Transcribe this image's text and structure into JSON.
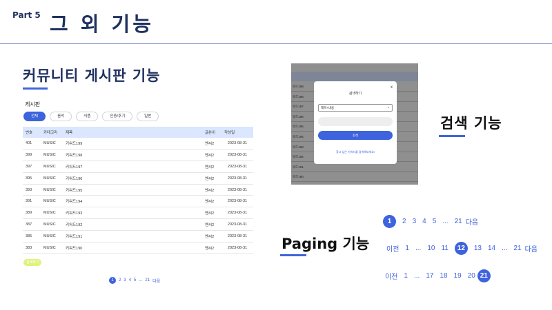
{
  "header": {
    "part": "Part 5",
    "title": "그 외 기능"
  },
  "sections": {
    "community": "커뮤니티 게시판 기능",
    "search": "검색 기능",
    "paging": "Paging 기능"
  },
  "board": {
    "title": "게시판",
    "categories": [
      "전체",
      "음악",
      "식품",
      "인증/후기",
      "일반"
    ],
    "columns": [
      "번호",
      "카테고리",
      "제목",
      "글쓴이",
      "작성일"
    ],
    "rows": [
      [
        "401",
        "MUSIC",
        "키워드199",
        "옌씨2",
        "2023-08-31"
      ],
      [
        "399",
        "MUSIC",
        "키워드198",
        "옌씨2",
        "2023-08-31"
      ],
      [
        "397",
        "MUSIC",
        "키워드197",
        "옌씨2",
        "2023-08-31"
      ],
      [
        "395",
        "MUSIC",
        "키워드196",
        "옌씨2",
        "2023-08-31"
      ],
      [
        "393",
        "MUSIC",
        "키워드195",
        "옌씨2",
        "2023-08-31"
      ],
      [
        "391",
        "MUSIC",
        "키워드194",
        "옌씨2",
        "2023-08-31"
      ],
      [
        "389",
        "MUSIC",
        "키워드193",
        "옌씨2",
        "2023-08-31"
      ],
      [
        "387",
        "MUSIC",
        "키워드192",
        "옌씨2",
        "2023-08-31"
      ],
      [
        "385",
        "MUSIC",
        "키워드191",
        "옌씨2",
        "2023-08-31"
      ],
      [
        "383",
        "MUSIC",
        "키워드190",
        "옌씨2",
        "2023-08-31"
      ]
    ],
    "write_label": "검색하기",
    "pager": [
      "1",
      "2",
      "3",
      "4",
      "5",
      "...",
      "21",
      "다음"
    ]
  },
  "search_modal": {
    "bg_rows": [
      "워드199",
      "워드198",
      "워드197",
      "워드196",
      "워드195",
      "워드194",
      "워드193",
      "워드192",
      "워드191",
      "워드190"
    ],
    "close": "x",
    "title": "검색하기",
    "select_value": "제목+내용",
    "button": "검색",
    "hint": "찾고 싶은 키워드를 검색해보세요!"
  },
  "paging": {
    "row1": [
      "1",
      "2",
      "3",
      "4",
      "5",
      "...",
      "21",
      "다음"
    ],
    "row2": [
      "이전",
      "1",
      "...",
      "10",
      "11",
      "12",
      "13",
      "14",
      "...",
      "21",
      "다음"
    ],
    "row3": [
      "이전",
      "1",
      "...",
      "17",
      "18",
      "19",
      "20",
      "21"
    ],
    "current1": "1",
    "current2": "12",
    "current3": "21"
  },
  "colors": {
    "accent": "#3d63dd",
    "title": "#1f3160",
    "header_row": "#dbe6ff"
  }
}
